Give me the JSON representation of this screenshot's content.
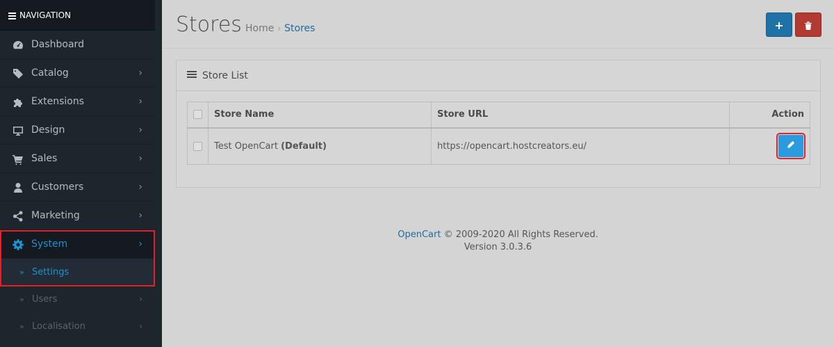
{
  "navigation": {
    "header": "NAVIGATION",
    "items": [
      {
        "label": "Dashboard",
        "icon": "dashboard-icon"
      },
      {
        "label": "Catalog",
        "icon": "tag-icon"
      },
      {
        "label": "Extensions",
        "icon": "puzzle-icon"
      },
      {
        "label": "Design",
        "icon": "monitor-icon"
      },
      {
        "label": "Sales",
        "icon": "cart-icon"
      },
      {
        "label": "Customers",
        "icon": "user-icon"
      },
      {
        "label": "Marketing",
        "icon": "share-icon"
      },
      {
        "label": "System",
        "icon": "gear-icon"
      }
    ],
    "sub_items": [
      {
        "label": "Settings"
      },
      {
        "label": "Users"
      },
      {
        "label": "Localisation"
      }
    ]
  },
  "page": {
    "title": "Stores",
    "breadcrumb": [
      "Home",
      "Stores"
    ]
  },
  "panel": {
    "title": "Store List",
    "columns": [
      "Store Name",
      "Store URL",
      "Action"
    ],
    "rows": [
      {
        "name": "Test OpenCart",
        "default_tag": "(Default)",
        "url": "https://opencart.hostcreators.eu/"
      }
    ]
  },
  "footer": {
    "brand": "OpenCart",
    "copyright": "© 2009-2020 All Rights Reserved.",
    "version": "Version 3.0.3.6"
  },
  "colors": {
    "accent": "#1e91cf",
    "danger": "#b23a30",
    "highlight_box": "#e5202a"
  }
}
